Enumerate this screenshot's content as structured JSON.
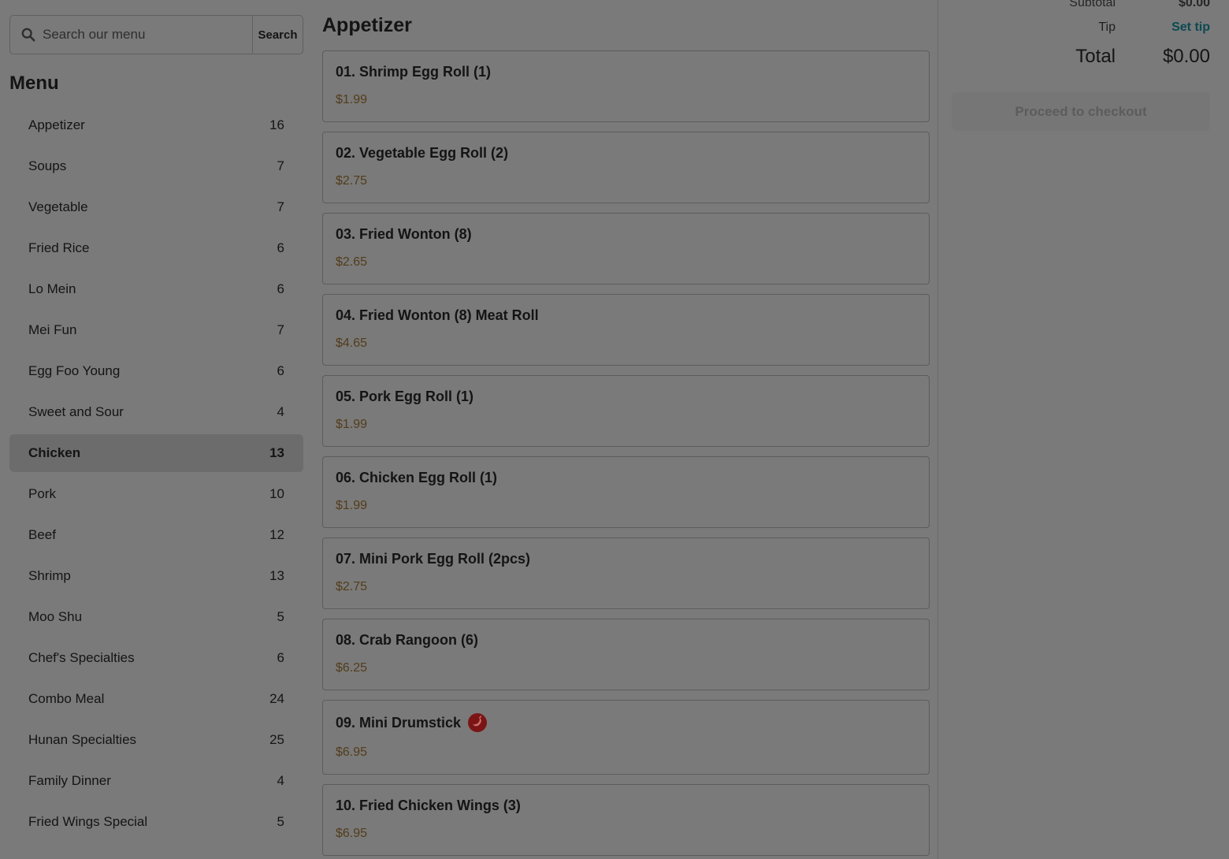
{
  "search": {
    "placeholder": "Search our menu",
    "button_label": "Search"
  },
  "menu": {
    "title": "Menu",
    "categories": [
      {
        "label": "Appetizer",
        "count": "16"
      },
      {
        "label": "Soups",
        "count": "7"
      },
      {
        "label": "Vegetable",
        "count": "7"
      },
      {
        "label": "Fried Rice",
        "count": "6"
      },
      {
        "label": "Lo Mein",
        "count": "6"
      },
      {
        "label": "Mei Fun",
        "count": "7"
      },
      {
        "label": "Egg Foo Young",
        "count": "6"
      },
      {
        "label": "Sweet and Sour",
        "count": "4"
      },
      {
        "label": "Chicken",
        "count": "13"
      },
      {
        "label": "Pork",
        "count": "10"
      },
      {
        "label": "Beef",
        "count": "12"
      },
      {
        "label": "Shrimp",
        "count": "13"
      },
      {
        "label": "Moo Shu",
        "count": "5"
      },
      {
        "label": "Chef's Specialties",
        "count": "6"
      },
      {
        "label": "Combo Meal",
        "count": "24"
      },
      {
        "label": "Hunan Specialties",
        "count": "25"
      },
      {
        "label": "Family Dinner",
        "count": "4"
      },
      {
        "label": "Fried Wings Special",
        "count": "5"
      }
    ],
    "active_category": "Chicken"
  },
  "section": {
    "title": "Appetizer",
    "items": [
      {
        "name": "01. Shrimp Egg Roll (1)",
        "price": "$1.99"
      },
      {
        "name": "02. Vegetable Egg Roll (2)",
        "price": "$2.75"
      },
      {
        "name": "03. Fried Wonton (8)",
        "price": "$2.65"
      },
      {
        "name": "04. Fried Wonton (8) Meat Roll",
        "price": "$4.65"
      },
      {
        "name": "05. Pork Egg Roll (1)",
        "price": "$1.99"
      },
      {
        "name": "06. Chicken Egg Roll (1)",
        "price": "$1.99"
      },
      {
        "name": "07. Mini Pork Egg Roll (2pcs)",
        "price": "$2.75"
      },
      {
        "name": "08. Crab Rangoon (6)",
        "price": "$6.25"
      },
      {
        "name": "09. Mini Drumstick",
        "price": "$6.95",
        "icon": "spicy-icon"
      },
      {
        "name": "10. Fried Chicken Wings (3)",
        "price": "$6.95"
      }
    ]
  },
  "cart": {
    "subtotal_label": "Subtotal",
    "subtotal_value": "$0.00",
    "tip_label": "Tip",
    "tip_action": "Set tip",
    "total_label": "Total",
    "total_value": "$0.00",
    "checkout_label": "Proceed to checkout"
  },
  "colors": {
    "overlay_bg": "#7a7a7a",
    "price": "#533c1a",
    "link": "#0b4a53",
    "spicy": "#7b1515"
  }
}
